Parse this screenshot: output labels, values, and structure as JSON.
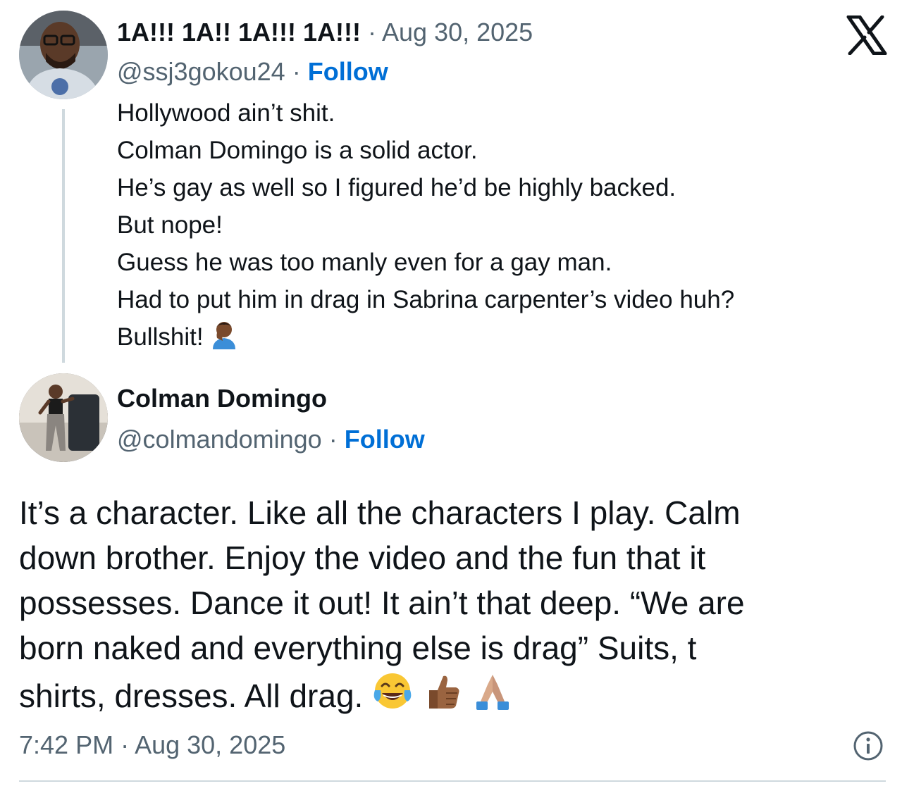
{
  "parent_tweet": {
    "display_name": "1A!!! 1A!! 1A!!! 1A!!!",
    "separator": "·",
    "date": "Aug 30, 2025",
    "handle": "@ssj3gokou24",
    "follow_label": "Follow",
    "lines": [
      "Hollywood ain’t shit.",
      "Colman Domingo is a solid actor.",
      "He’s gay as well so I figured he’d be highly backed.",
      "But nope!",
      "Guess he was too manly even for a gay man.",
      "Had to put him in drag in Sabrina carpenter’s video huh?",
      "Bullshit!"
    ],
    "emoji_icon": "man-facepalming-medium-dark-skin-icon"
  },
  "reply_tweet": {
    "display_name": "Colman Domingo",
    "separator": "·",
    "handle": "@colmandomingo",
    "follow_label": "Follow",
    "lines": [
      "It’s a character. Like all the characters I play. Calm",
      "down brother. Enjoy the video and the fun that it",
      "possesses. Dance it out! It ain’t that deep. “We are",
      "born naked and everything else is drag” Suits, t",
      "shirts, dresses. All drag."
    ],
    "emoji_icons": [
      "face-with-tears-of-joy-icon",
      "thumbs-up-medium-dark-skin-icon",
      "folded-hands-medium-light-skin-icon"
    ],
    "timestamp": "7:42 PM · Aug 30, 2025"
  },
  "icons": {
    "brand": "x-logo-icon",
    "info": "info-icon"
  },
  "colors": {
    "text": "#0f1419",
    "muted": "#536471",
    "link": "#006fd6",
    "divider": "#cfd9de"
  }
}
